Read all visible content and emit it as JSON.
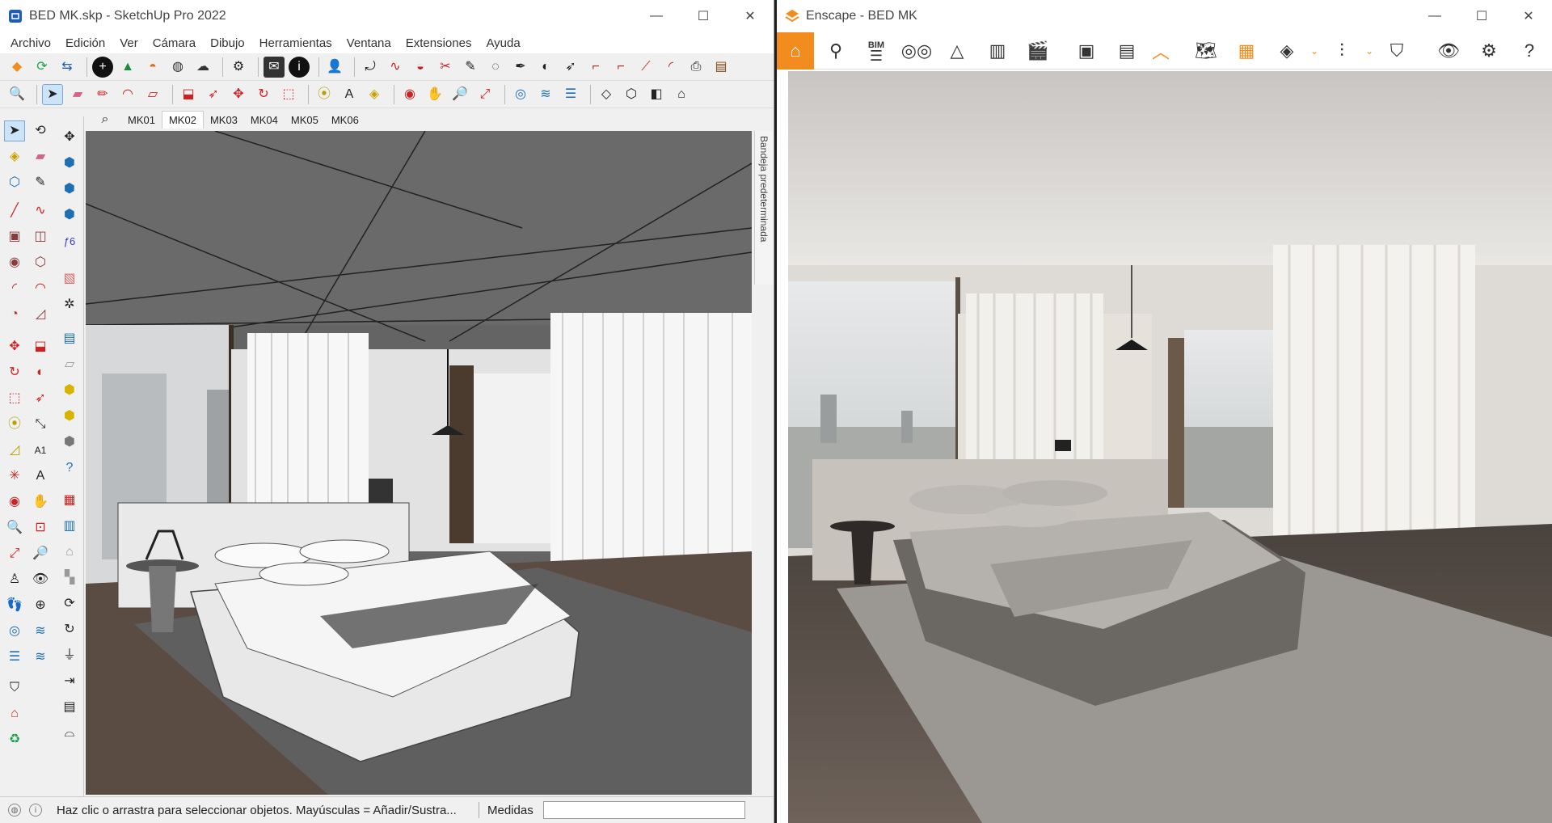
{
  "sketchup": {
    "title": "BED MK.skp - SketchUp Pro 2022",
    "menu": [
      "Archivo",
      "Edición",
      "Ver",
      "Cámara",
      "Dibujo",
      "Herramientas",
      "Ventana",
      "Extensiones",
      "Ayuda"
    ],
    "scene_tabs": [
      "MK01",
      "MK02",
      "MK03",
      "MK04",
      "MK05",
      "MK06"
    ],
    "active_scene": "MK02",
    "tray_label": "Bandeja predeterminada",
    "status_text": "Haz clic o arrastra para seleccionar objetos. Mayúsculas = Añadir/Sustra...",
    "measurements_label": "Medidas",
    "measurements_value": ""
  },
  "enscape": {
    "title": "Enscape - BED MK",
    "bim_label": "BIM",
    "accent_color": "#f28c1e"
  },
  "window_controls": {
    "minimize": "—",
    "maximize": "☐",
    "close": "✕"
  }
}
